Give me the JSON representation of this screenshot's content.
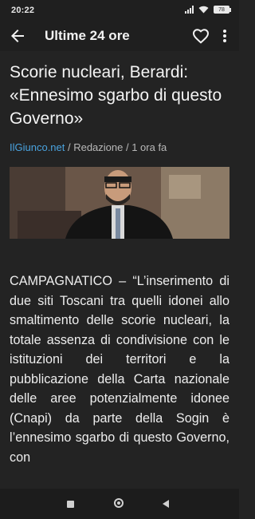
{
  "status": {
    "time": "20:22",
    "battery": "78"
  },
  "appbar": {
    "title": "Ultime 24 ore"
  },
  "article": {
    "headline": "Scorie nucleari, Berardi: «Ennesimo sgarbo di questo Governo»",
    "source": "IlGiunco.net",
    "meta_rest": " / Redazione / 1 ora fa",
    "body": "CAMPAGNATICO – “L’inserimento di due siti Toscani tra quelli idonei allo smaltimento delle scorie nucleari, la totale assenza di condivisione con le istituzioni dei territori e la pubblicazione della Carta nazionale delle aree potenzialmente idonee (Cnapi) da parte della Sogin è l’ennesimo sgarbo di questo Governo, con"
  },
  "icons": {
    "back": "arrow-left-icon",
    "favorite": "heart-outline-icon",
    "more": "more-vertical-icon"
  },
  "colors": {
    "accent_link": "#4aa3df",
    "background": "#232323"
  }
}
